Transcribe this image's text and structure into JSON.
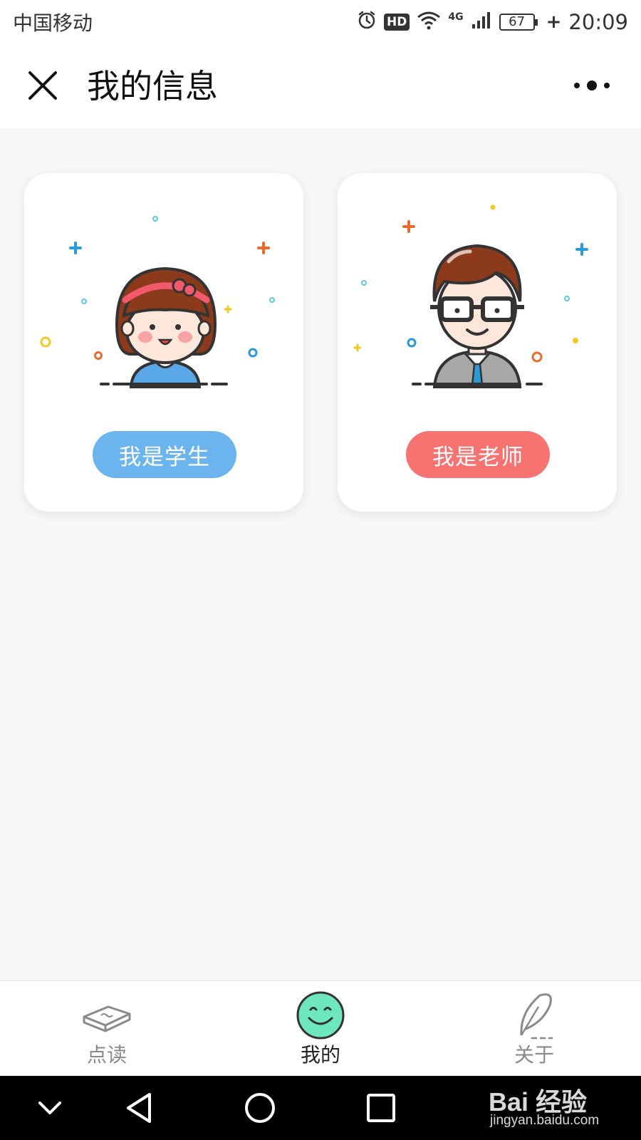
{
  "status_bar": {
    "carrier": "中国移动",
    "hd": "HD",
    "network": "4G",
    "battery": "67",
    "time": "20:09"
  },
  "header": {
    "title": "我的信息",
    "close_icon": "close-icon",
    "more_icon": "more-dots-icon"
  },
  "cards": [
    {
      "role": "student",
      "button_label": "我是学生",
      "button_color": "#6cb4ee",
      "illustration": "girl-avatar"
    },
    {
      "role": "teacher",
      "button_label": "我是老师",
      "button_color": "#f67372",
      "illustration": "teacher-avatar"
    }
  ],
  "tab_bar": {
    "items": [
      {
        "label": "点读",
        "icon": "book-icon",
        "active": false
      },
      {
        "label": "我的",
        "icon": "smile-icon",
        "active": true
      },
      {
        "label": "关于",
        "icon": "feather-icon",
        "active": false
      }
    ]
  },
  "nav_bar": {
    "buttons": [
      "collapse-icon",
      "back-icon",
      "home-icon",
      "recents-icon"
    ]
  },
  "watermark": {
    "brand": "Bai 经验",
    "url": "jingyan.baidu.com"
  },
  "colors": {
    "student_accent": "#6cb4ee",
    "teacher_accent": "#f67372",
    "active_tab": "#6ee7c1"
  }
}
